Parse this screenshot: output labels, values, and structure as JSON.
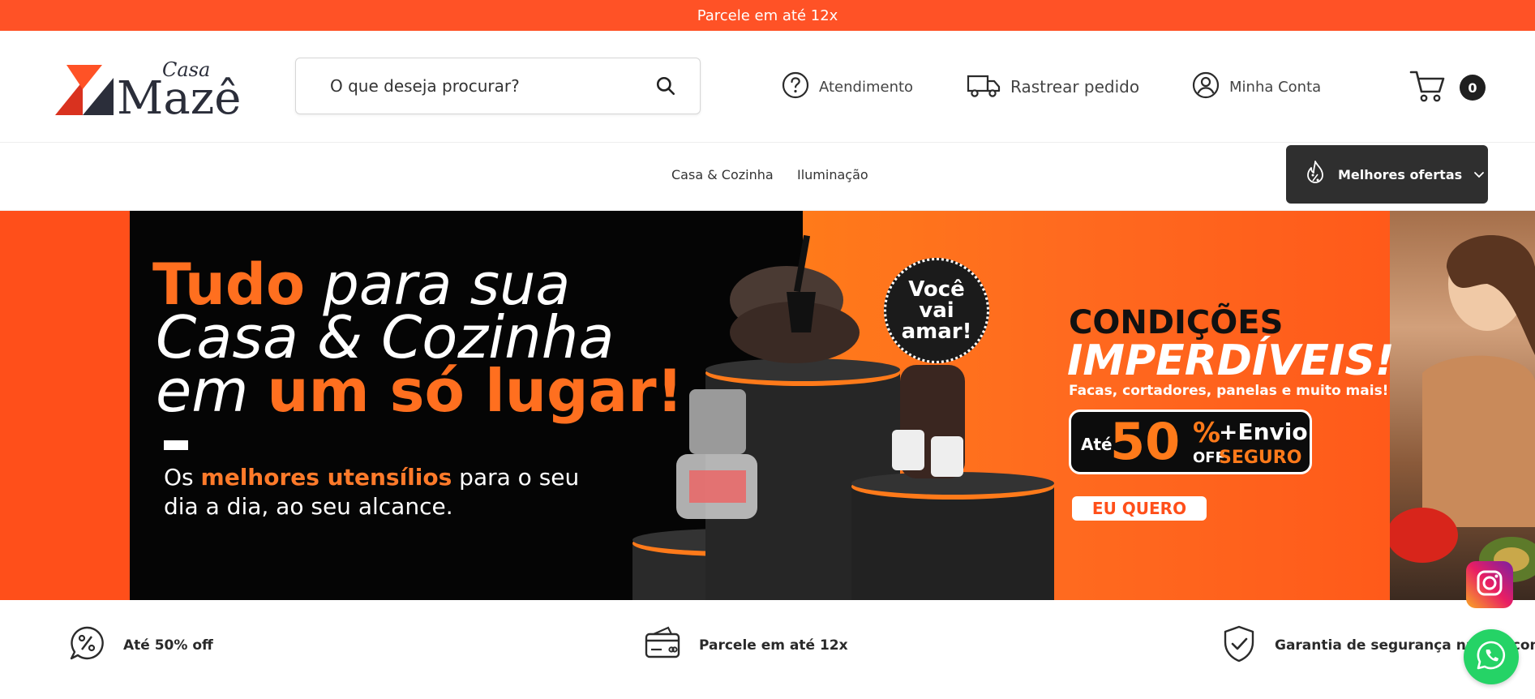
{
  "topbar": {
    "text": "Parcele em até 12x"
  },
  "logo": {
    "script": "Casa",
    "name": "Mazê"
  },
  "search": {
    "placeholder": "O que deseja procurar?",
    "icon": "search-icon"
  },
  "header_links": {
    "support": {
      "label": "Atendimento",
      "icon": "question-circle-icon"
    },
    "tracking": {
      "label": "Rastrear pedido",
      "icon": "truck-icon"
    },
    "account": {
      "label": "Minha Conta",
      "icon": "user-circle-icon"
    },
    "cart": {
      "count": "0",
      "icon": "cart-icon"
    }
  },
  "nav": {
    "items": [
      "Casa & Cozinha",
      "Iluminação"
    ],
    "offers_button": {
      "label": "Melhores ofertas",
      "icon": "discount-flame-icon"
    }
  },
  "banner": {
    "headline_1_bold": "Tudo",
    "headline_1_rest": " para sua",
    "headline_2": "Casa & Cozinha",
    "headline_3_light": "em ",
    "headline_3_bold": "um só lugar!",
    "sub_1_pre": "Os ",
    "sub_1_bold": "melhores utensílios",
    "sub_1_post": " para o seu",
    "sub_2": "dia a dia, ao seu alcance.",
    "sticker": [
      "Você",
      "vai",
      "amar!"
    ],
    "conditions": "CONDIÇÕES",
    "imperdiveis": "IMPERDÍVEIS!",
    "products_line": "Facas, cortadores, panelas e muito mais!",
    "promo": {
      "ate": "Até",
      "value": "50",
      "pct": "%",
      "off": "OFF",
      "envio": "+Envio",
      "seguro": "SEGURO"
    },
    "cta": "EU QUERO"
  },
  "benefits": [
    {
      "text": "Até 50% off",
      "icon": "percent-chat-icon"
    },
    {
      "text": "Parcele em até 12x",
      "icon": "credit-card-icon"
    },
    {
      "text": "Garantia de segurança na sua compra",
      "icon": "shield-check-icon"
    }
  ],
  "colors": {
    "brand_orange": "#ff5226",
    "dark": "#2f2f2f",
    "whatsapp": "#25d366"
  }
}
